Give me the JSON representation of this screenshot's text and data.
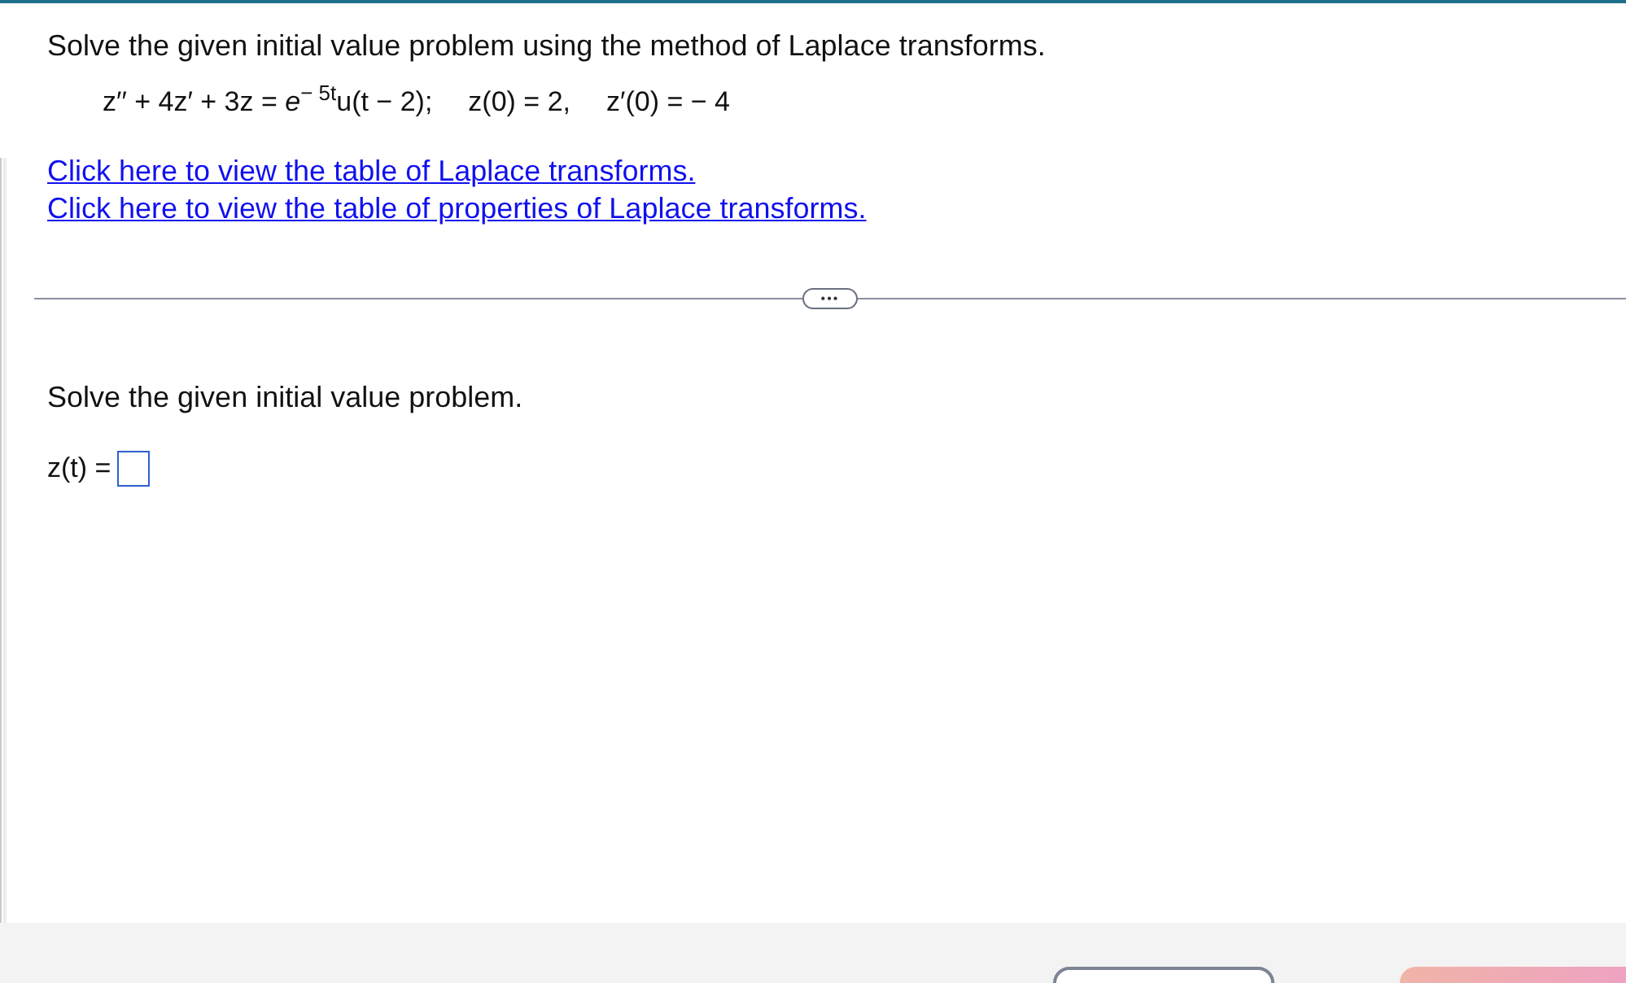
{
  "question": {
    "prompt": "Solve the given initial value problem using the method of Laplace transforms.",
    "equation": [
      "z′′ + 4z′ + 3z = *e*$^{− 5t}$u(t − 2);",
      "z(0) = 2,",
      "z′(0) = − 4"
    ],
    "links": [
      "Click here to view the table of Laplace transforms.",
      "Click here to view the table of properties of Laplace transforms."
    ]
  },
  "expand_button": {
    "label": "•••"
  },
  "answer": {
    "prompt": "Solve the given initial value problem.",
    "label": "z(t) ="
  },
  "footer": {
    "buttons": [
      {
        "kind": "outline"
      },
      {
        "kind": "primary"
      }
    ]
  }
}
